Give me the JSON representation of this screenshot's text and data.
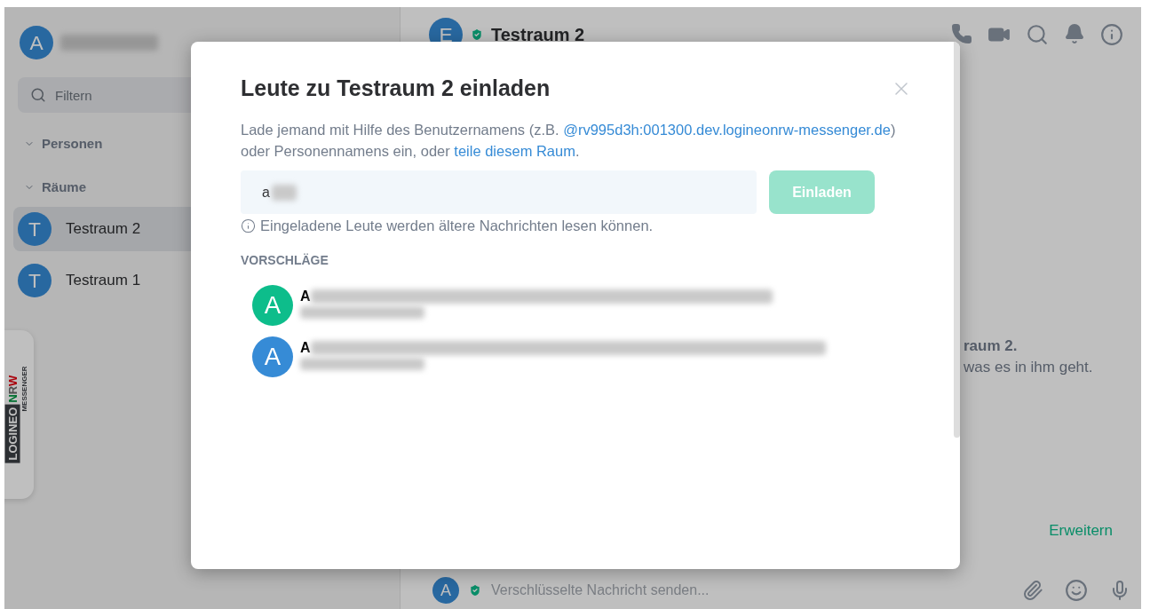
{
  "sidebar": {
    "user": {
      "avatar_letter": "A"
    },
    "filter": {
      "placeholder": "Filtern"
    },
    "sections": [
      {
        "label": "Personen",
        "expanded": true
      },
      {
        "label": "Räume",
        "expanded": true
      }
    ],
    "rooms": [
      {
        "avatar_letter": "T",
        "name": "Testraum 2",
        "selected": true
      },
      {
        "avatar_letter": "T",
        "name": "Testraum 1",
        "selected": false
      }
    ],
    "logo": {
      "brand": "LOGINEO",
      "region": "NRW",
      "product": "MESSENGER"
    }
  },
  "room": {
    "avatar_letter": "E",
    "title": "Testraum 2",
    "intro_lines": [
      "raum 2.",
      "was es in ihm geht."
    ],
    "expand_link": "Erweitern",
    "composer": {
      "avatar_letter": "A",
      "placeholder": "Verschlüsselte Nachricht senden..."
    }
  },
  "dialog": {
    "title": "Leute zu Testraum 2 einladen",
    "description_parts": [
      "Lade jemand mit Hilfe des Benutzernamens (z.B. ",
      "@rv995d3h:001300.dev.logineonrw-messenger.de",
      ") oder Personennamens ein, oder ",
      "teile diesem Raum",
      "."
    ],
    "input_value": "a",
    "invite_button": {
      "label": "Einladen",
      "disabled": true
    },
    "notice": "Eingeladene Leute werden ältere Nachrichten lesen können.",
    "suggestions_heading": "VORSCHLÄGE",
    "suggestions": [
      {
        "avatar_letter": "A",
        "name": "A",
        "color": "#0dbd8b"
      },
      {
        "avatar_letter": "A",
        "name": "A",
        "color": "#368bd6"
      }
    ]
  }
}
